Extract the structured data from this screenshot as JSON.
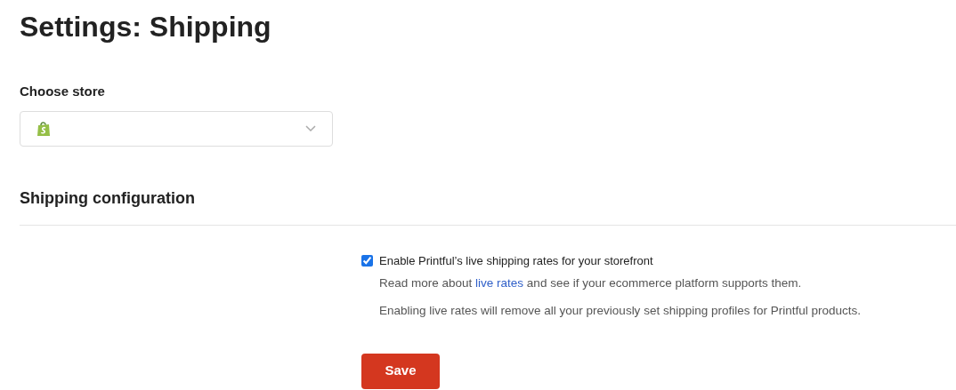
{
  "title": "Settings: Shipping",
  "store_select": {
    "label": "Choose store"
  },
  "section": {
    "heading": "Shipping configuration"
  },
  "live_rates": {
    "label": "Enable Printful’s live shipping rates for your storefront",
    "checked": true,
    "info": {
      "before": "Read more about ",
      "link": "live rates",
      "after": " and see if your ecommerce platform supports them."
    },
    "warning": "Enabling live rates will remove all your previously set shipping profiles for Printful products."
  },
  "save_button": "Save"
}
